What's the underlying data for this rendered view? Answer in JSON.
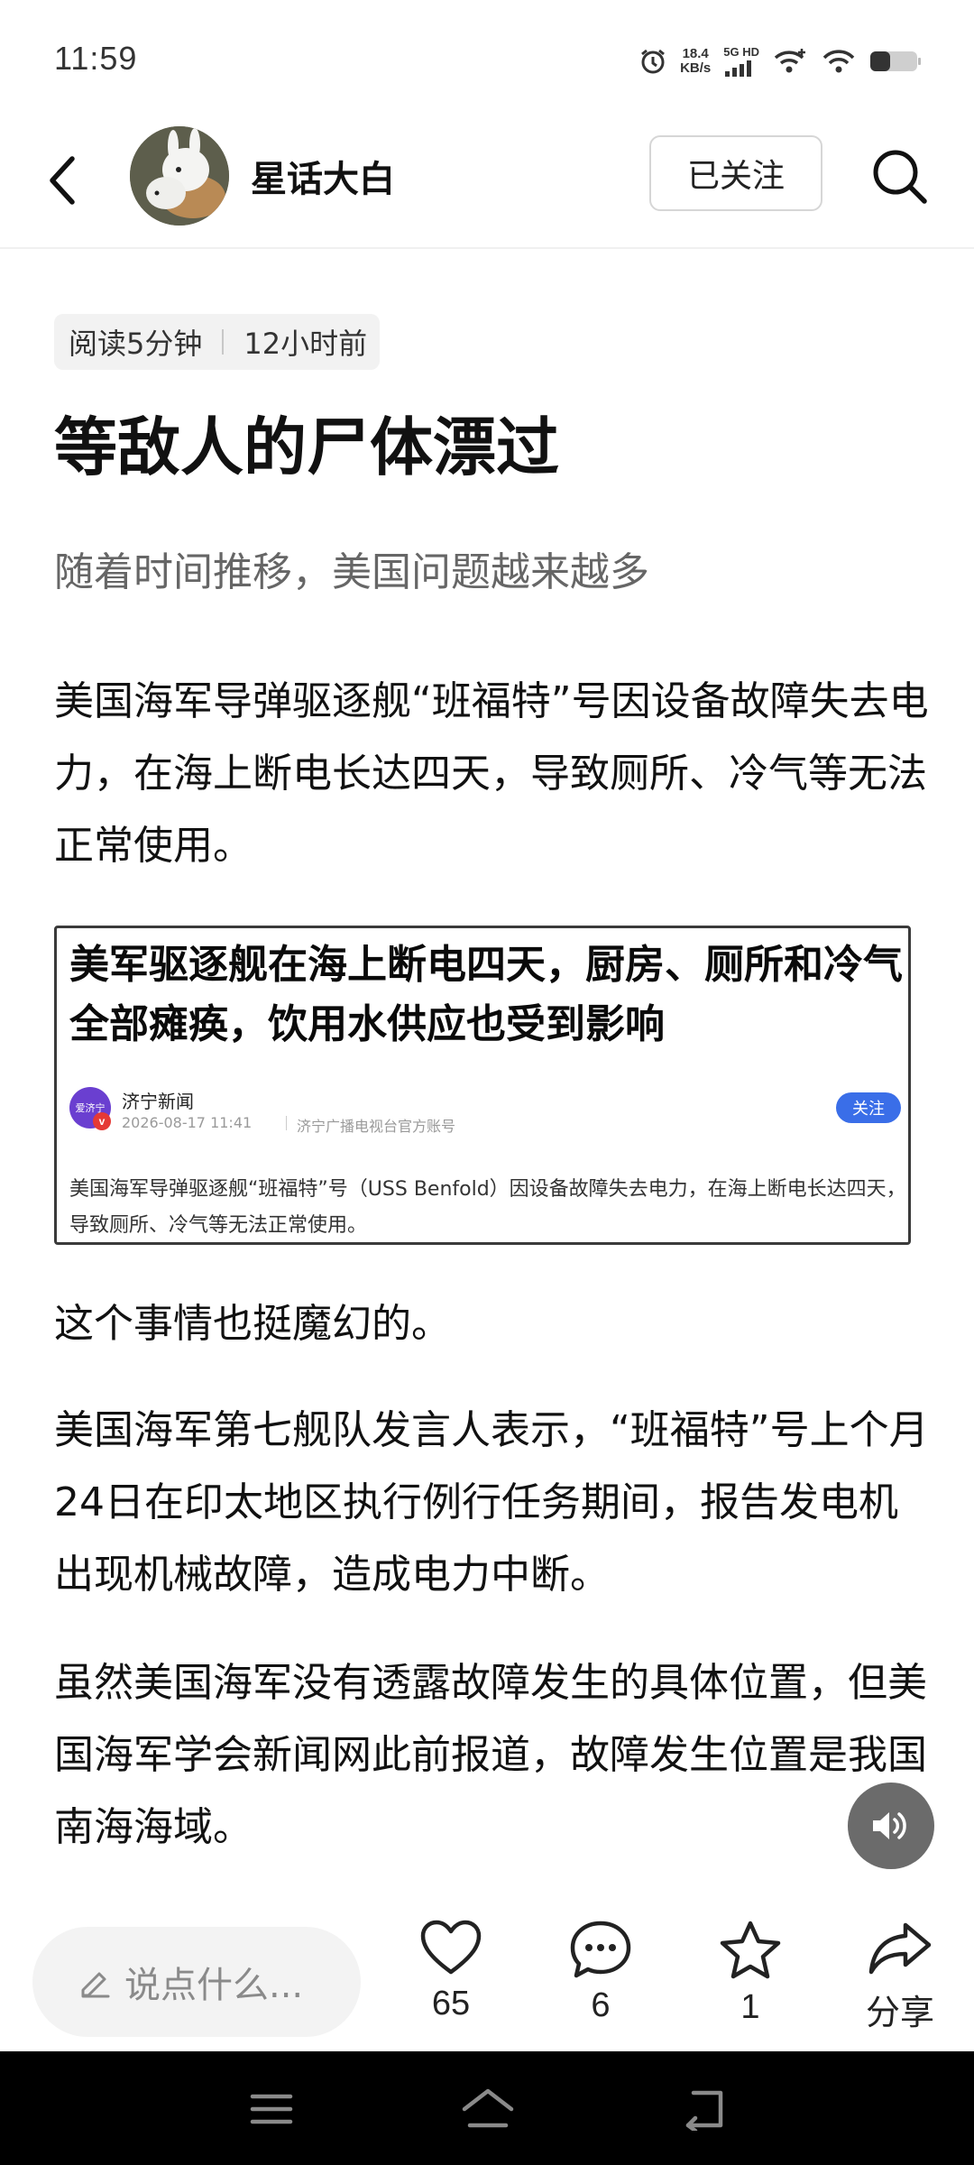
{
  "status_bar": {
    "time": "11:59",
    "net_speed_value": "18.4",
    "net_speed_unit": "KB/s",
    "network_gen": "5G HD",
    "icons": [
      "alarm-icon",
      "signal-icon",
      "wifi-calling-icon",
      "wifi-icon",
      "battery-icon"
    ]
  },
  "header": {
    "author_name": "星话大白",
    "follow_label": "已关注",
    "icons": [
      "back-icon",
      "search-icon"
    ]
  },
  "article": {
    "read_time": "阅读5分钟",
    "published": "12小时前",
    "title": "等敌人的尸体漂过",
    "subtitle": "随着时间推移，美国问题越来越多",
    "paragraphs": [
      "美国海军导弹驱逐舰“班福特”号因设备故障失去电力，在海上断电长达四天，导致厕所、冷气等无法正常使用。",
      "这个事情也挺魔幻的。",
      "美国海军第七舰队发言人表示，“班福特”号上个月24日在印太地区执行例行任务期间，报告发电机出现机械故障，造成电力中断。",
      "虽然美国海军没有透露故障发生的具体位置，但美国海军学会新闻网此前报道，故障发生位置是我国南海海域。"
    ],
    "embed": {
      "headline": "美军驱逐舰在海上断电四天，厨房、厕所和冷气全部瘫痪，饮用水供应也受到影响",
      "source_name": "济宁新闻",
      "logo_text": "爱济宁",
      "date": "2026-08-17 11:41",
      "org": "济宁广播电视台官方账号",
      "follow_label": "关注",
      "body": "美国海军导弹驱逐舰“班福特”号（USS Benfold）因设备故障失去电力，在海上断电长达四天，导致厕所、冷气等无法正常使用。"
    }
  },
  "action_bar": {
    "comment_placeholder": "说点什么...",
    "likes": "65",
    "comments": "6",
    "favorites": "1",
    "share_label": "分享"
  },
  "colors": {
    "accent_blue": "#3a6ee8",
    "text_primary": "#111111",
    "text_secondary": "#666666",
    "chip_bg": "#f2f2f2"
  }
}
